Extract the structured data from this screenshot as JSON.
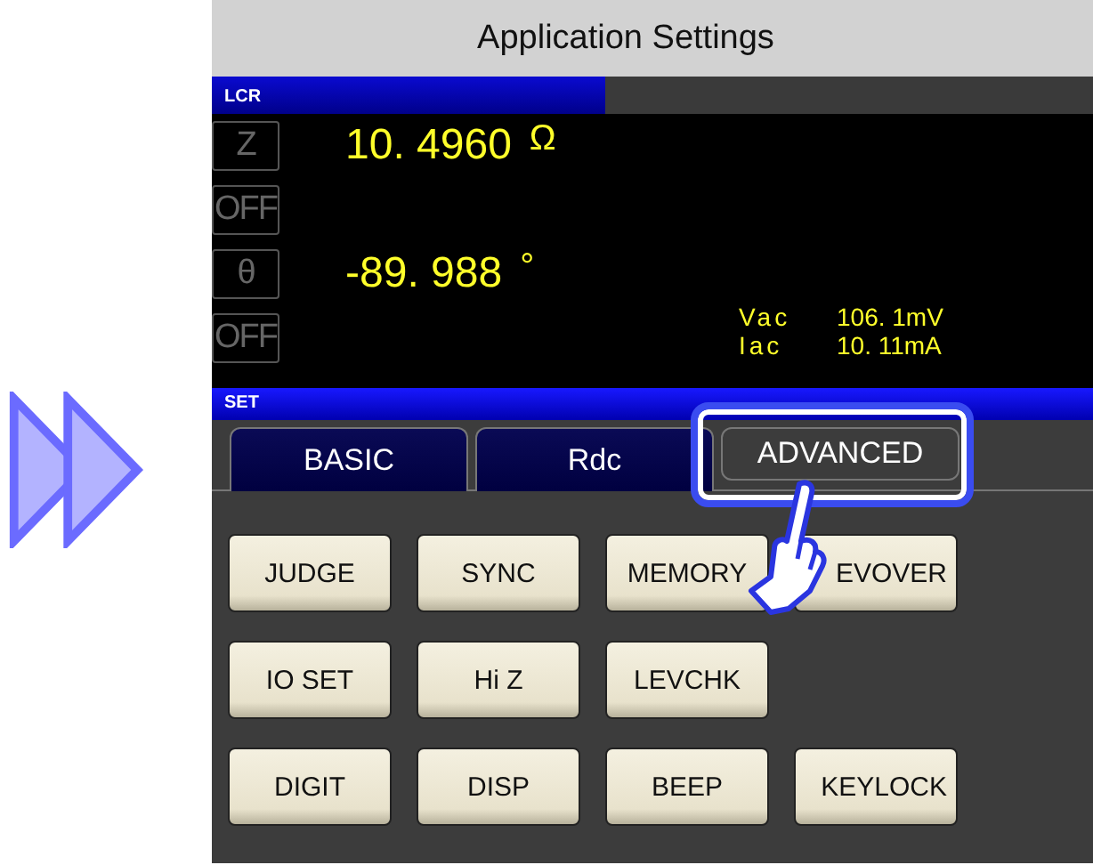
{
  "title": "Application Settings",
  "measure": {
    "label": "LCR",
    "rows": [
      {
        "param": "Z",
        "value": "10. 4960",
        "unit": "Ω"
      },
      {
        "param": "OFF"
      },
      {
        "param": "θ",
        "value": "-89. 988",
        "unit": "°"
      },
      {
        "param": "OFF"
      }
    ],
    "monitor": [
      {
        "name": "Vac",
        "value": "106. 1mV"
      },
      {
        "name": "Iac",
        "value": "10. 11mA"
      }
    ]
  },
  "set": {
    "label": "SET",
    "tabs": [
      {
        "label": "BASIC",
        "selected": false
      },
      {
        "label": "Rdc",
        "selected": false
      },
      {
        "label": "ADVANCED",
        "selected": true
      }
    ],
    "buttons": [
      [
        "JUDGE",
        "SYNC",
        "MEMORY",
        "EVOVER"
      ],
      [
        "IO SET",
        "Hi Z",
        "LEVCHK"
      ],
      [
        "DIGIT",
        "DISP",
        "BEEP",
        "KEYLOCK"
      ]
    ]
  }
}
